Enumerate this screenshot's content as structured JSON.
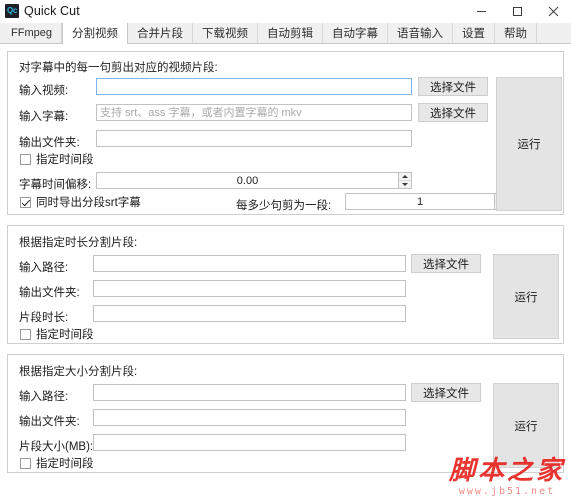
{
  "window": {
    "title": "Quick Cut",
    "icon_label": "Qc",
    "icon_name": "app-icon",
    "controls": {
      "minimize": "minimize-icon",
      "maximize": "maximize-icon",
      "close": "close-icon"
    }
  },
  "tabs": [
    {
      "label": "FFmpeg",
      "active": false
    },
    {
      "label": "分割视频",
      "active": true
    },
    {
      "label": "合并片段",
      "active": false
    },
    {
      "label": "下载视频",
      "active": false
    },
    {
      "label": "自动剪辑",
      "active": false
    },
    {
      "label": "自动字幕",
      "active": false
    },
    {
      "label": "语音输入",
      "active": false
    },
    {
      "label": "设置",
      "active": false
    },
    {
      "label": "帮助",
      "active": false
    }
  ],
  "panels": {
    "subtitle_split": {
      "title": "对字幕中的每一句剪出对应的视频片段:",
      "input_video": {
        "label": "输入视频:",
        "value": "",
        "placeholder": ""
      },
      "input_subtitle": {
        "label": "输入字幕:",
        "value": "",
        "placeholder": "支持 srt、ass 字幕，或者内置字幕的 mkv"
      },
      "output_folder": {
        "label": "输出文件夹:",
        "value": "",
        "placeholder": ""
      },
      "specify_time_range": {
        "label": "指定时间段",
        "checked": false
      },
      "subtitle_time_offset": {
        "label": "字幕时间偏移:",
        "value": "0.00"
      },
      "export_srt": {
        "label": "同时导出分段srt字幕",
        "checked": true
      },
      "sentences_per_clip": {
        "label": "每多少句剪为一段:",
        "value": "1"
      },
      "choose_file_video": "选择文件",
      "choose_file_subtitle": "选择文件",
      "run": "运行"
    },
    "duration_split": {
      "title": "根据指定时长分割片段:",
      "input_path": {
        "label": "输入路径:",
        "value": "",
        "placeholder": ""
      },
      "output_folder": {
        "label": "输出文件夹:",
        "value": "",
        "placeholder": ""
      },
      "clip_duration": {
        "label": "片段时长:",
        "value": "",
        "placeholder": ""
      },
      "specify_time_range": {
        "label": "指定时间段",
        "checked": false
      },
      "choose_file": "选择文件",
      "run": "运行"
    },
    "size_split": {
      "title": "根据指定大小分割片段:",
      "input_path": {
        "label": "输入路径:",
        "value": "",
        "placeholder": ""
      },
      "output_folder": {
        "label": "输出文件夹:",
        "value": "",
        "placeholder": ""
      },
      "clip_size": {
        "label": "片段大小(MB):",
        "value": "",
        "placeholder": ""
      },
      "specify_time_range": {
        "label": "指定时间段",
        "checked": false
      },
      "choose_file": "选择文件",
      "run": "运行"
    }
  },
  "watermark": {
    "text": "脚本之家",
    "url": "www.jb51.net",
    "color": "#e8231f"
  }
}
